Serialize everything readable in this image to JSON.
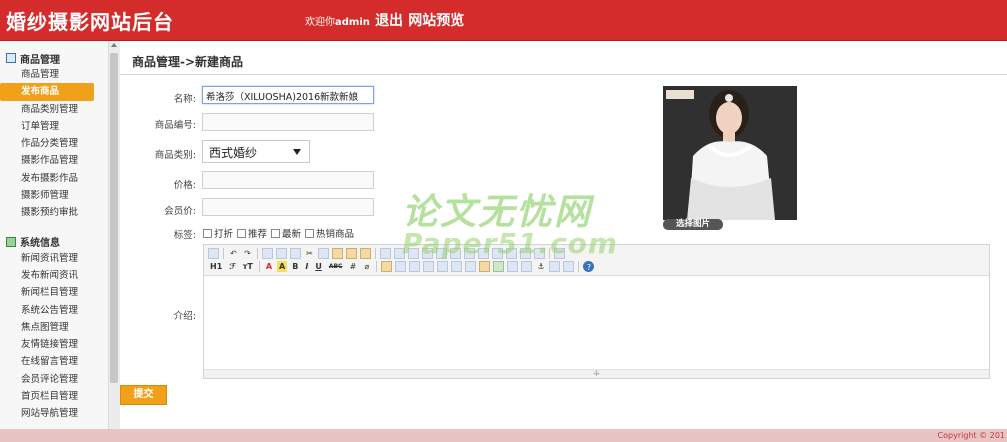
{
  "header": {
    "title": "婚纱摄影网站后台",
    "welcome_prefix": "欢迎你",
    "username": "admin",
    "logout": "退出",
    "site_preview": "网站预览",
    "bg_color": "#d42b2b"
  },
  "sidebar": {
    "groups": [
      {
        "title": "商品管理",
        "icon": "folder-icon",
        "items": [
          "商品管理",
          "发布商品",
          "商品类别管理",
          "订单管理",
          "作品分类管理",
          "摄影作品管理",
          "发布摄影作品",
          "摄影师管理",
          "摄影预约审批"
        ],
        "active_item": "发布商品"
      },
      {
        "title": "系统信息",
        "icon": "system-icon",
        "items": [
          "新闻资讯管理",
          "发布新闻资讯",
          "新闻栏目管理",
          "系统公告管理",
          "焦点图管理",
          "友情链接管理",
          "在线留言管理",
          "会员评论管理",
          "首页栏目管理",
          "网站导航管理"
        ]
      }
    ],
    "active_color": "#f0a019"
  },
  "main": {
    "breadcrumb": "商品管理->新建商品",
    "form": {
      "name_label": "名称:",
      "name_value": "希洛莎（XILUOSHA)2016新款新娘",
      "code_label": "商品编号:",
      "code_value": "",
      "category_label": "商品类别:",
      "category_value": "西式婚纱",
      "price_label": "价格:",
      "price_value": "",
      "member_price_label": "会员价:",
      "member_price_value": "",
      "tags_label": "标签:",
      "tags": [
        "打折",
        "推荐",
        "最新",
        "热销商品"
      ],
      "intro_label": "介绍:",
      "submit": "提交",
      "choose_image": "选择图片"
    },
    "editor": {
      "row2_text": [
        "H1",
        "ℱ",
        "тT",
        "A",
        "A",
        "B",
        "I",
        "U",
        "ABC"
      ]
    }
  },
  "watermark": {
    "line1": "论文无忧网",
    "line2": "Paper51.com"
  },
  "footer": {
    "copyright": "Copyright © 201"
  }
}
